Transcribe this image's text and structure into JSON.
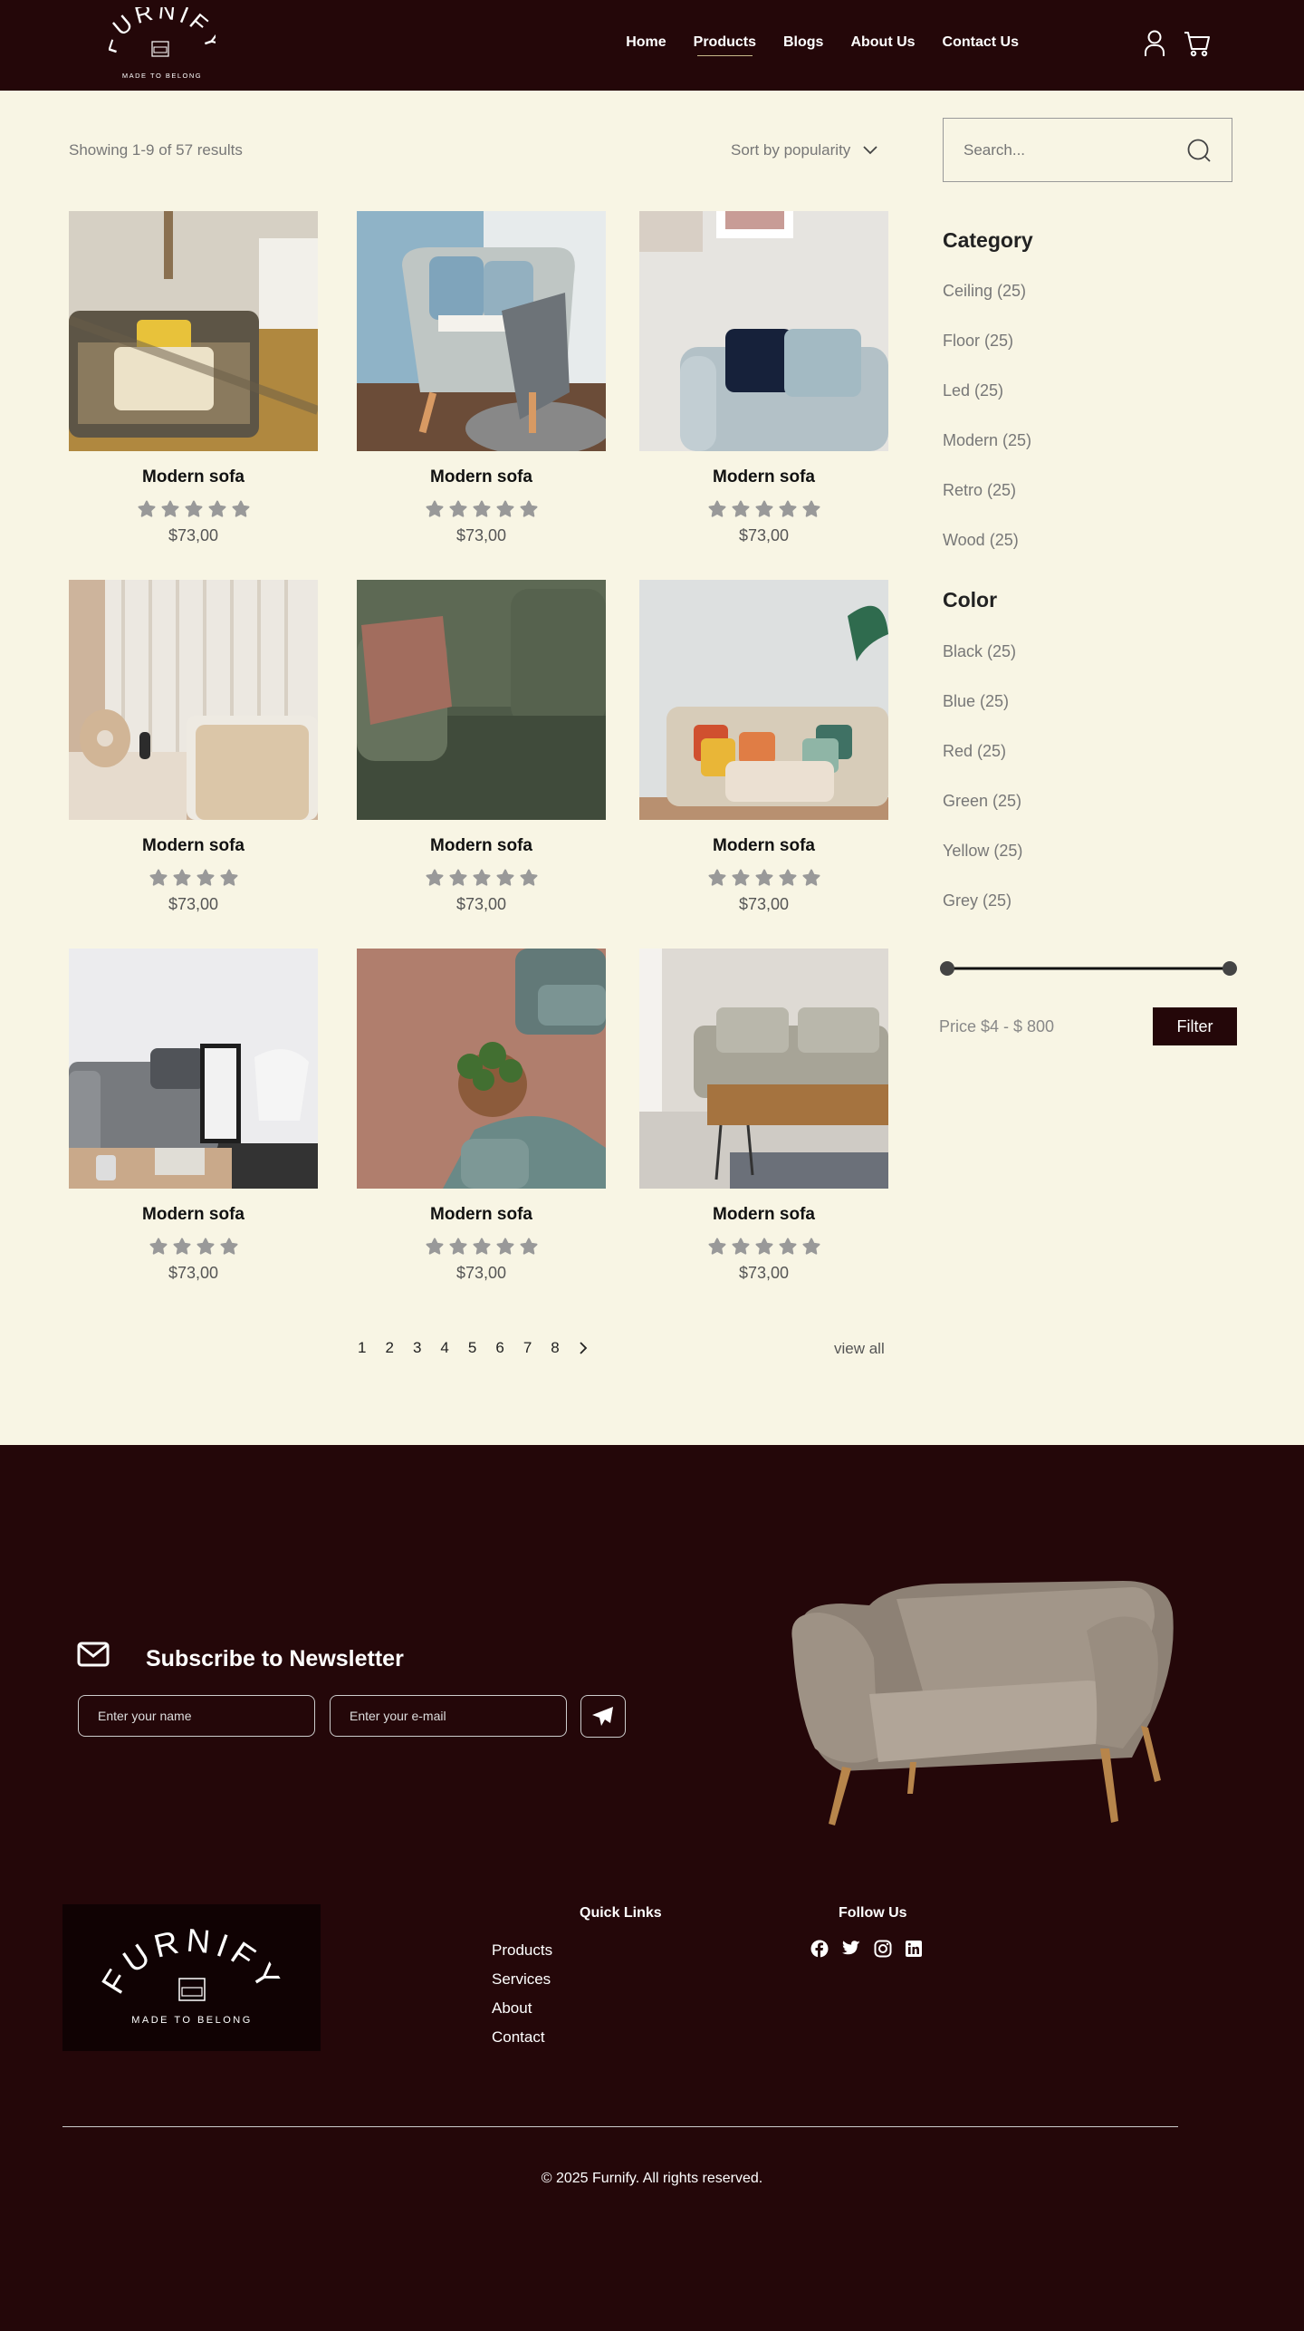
{
  "header": {
    "logo_text": "FURNIFY",
    "logo_tagline": "MADE TO BELONG",
    "nav": [
      {
        "label": "Home",
        "active": false
      },
      {
        "label": "Products",
        "active": true
      },
      {
        "label": "Blogs",
        "active": false
      },
      {
        "label": "About Us",
        "active": false
      },
      {
        "label": "Contact Us",
        "active": false
      }
    ],
    "icons": [
      "user-icon",
      "cart-icon"
    ]
  },
  "toolbar": {
    "results_text": "Showing 1-9 of 57 results",
    "sort_label": "Sort by popularity"
  },
  "products": [
    {
      "name": "Modern sofa",
      "price": "$73,00",
      "rating": 5
    },
    {
      "name": "Modern sofa",
      "price": "$73,00",
      "rating": 5
    },
    {
      "name": "Modern sofa",
      "price": "$73,00",
      "rating": 5
    },
    {
      "name": "Modern sofa",
      "price": "$73,00",
      "rating": 4
    },
    {
      "name": "Modern sofa",
      "price": "$73,00",
      "rating": 5
    },
    {
      "name": "Modern sofa",
      "price": "$73,00",
      "rating": 5
    },
    {
      "name": "Modern sofa",
      "price": "$73,00",
      "rating": 4
    },
    {
      "name": "Modern sofa",
      "price": "$73,00",
      "rating": 5
    },
    {
      "name": "Modern sofa",
      "price": "$73,00",
      "rating": 5
    }
  ],
  "pagination": {
    "pages": [
      "1",
      "2",
      "3",
      "4",
      "5",
      "6",
      "7",
      "8"
    ],
    "view_all": "view all"
  },
  "sidebar": {
    "search_placeholder": "Search...",
    "category_title": "Category",
    "categories": [
      "Ceiling (25)",
      "Floor (25)",
      "Led (25)",
      "Modern (25)",
      "Retro (25)",
      "Wood (25)"
    ],
    "color_title": "Color",
    "colors": [
      "Black (25)",
      "Blue (25)",
      "Red (25)",
      "Green (25)",
      "Yellow (25)",
      "Grey (25)"
    ],
    "price_label": "Price $4 - $ 800",
    "filter_label": "Filter"
  },
  "newsletter": {
    "title": "Subscribe to Newsletter",
    "name_placeholder": "Enter your name",
    "email_placeholder": "Enter your e-mail"
  },
  "footer": {
    "logo_text": "FURNIFY",
    "logo_tagline": "MADE TO BELONG",
    "quick_links_title": "Quick Links",
    "quick_links": [
      "Products",
      "Services",
      "About",
      "Contact"
    ],
    "follow_title": "Follow Us",
    "social": [
      "facebook-icon",
      "twitter-icon",
      "instagram-icon",
      "linkedin-icon"
    ],
    "copyright": "© 2025 Furnify. All rights reserved."
  },
  "colors": {
    "brand_dark": "#240709",
    "page_bg": "#f8f5e4",
    "star": "#999999"
  }
}
